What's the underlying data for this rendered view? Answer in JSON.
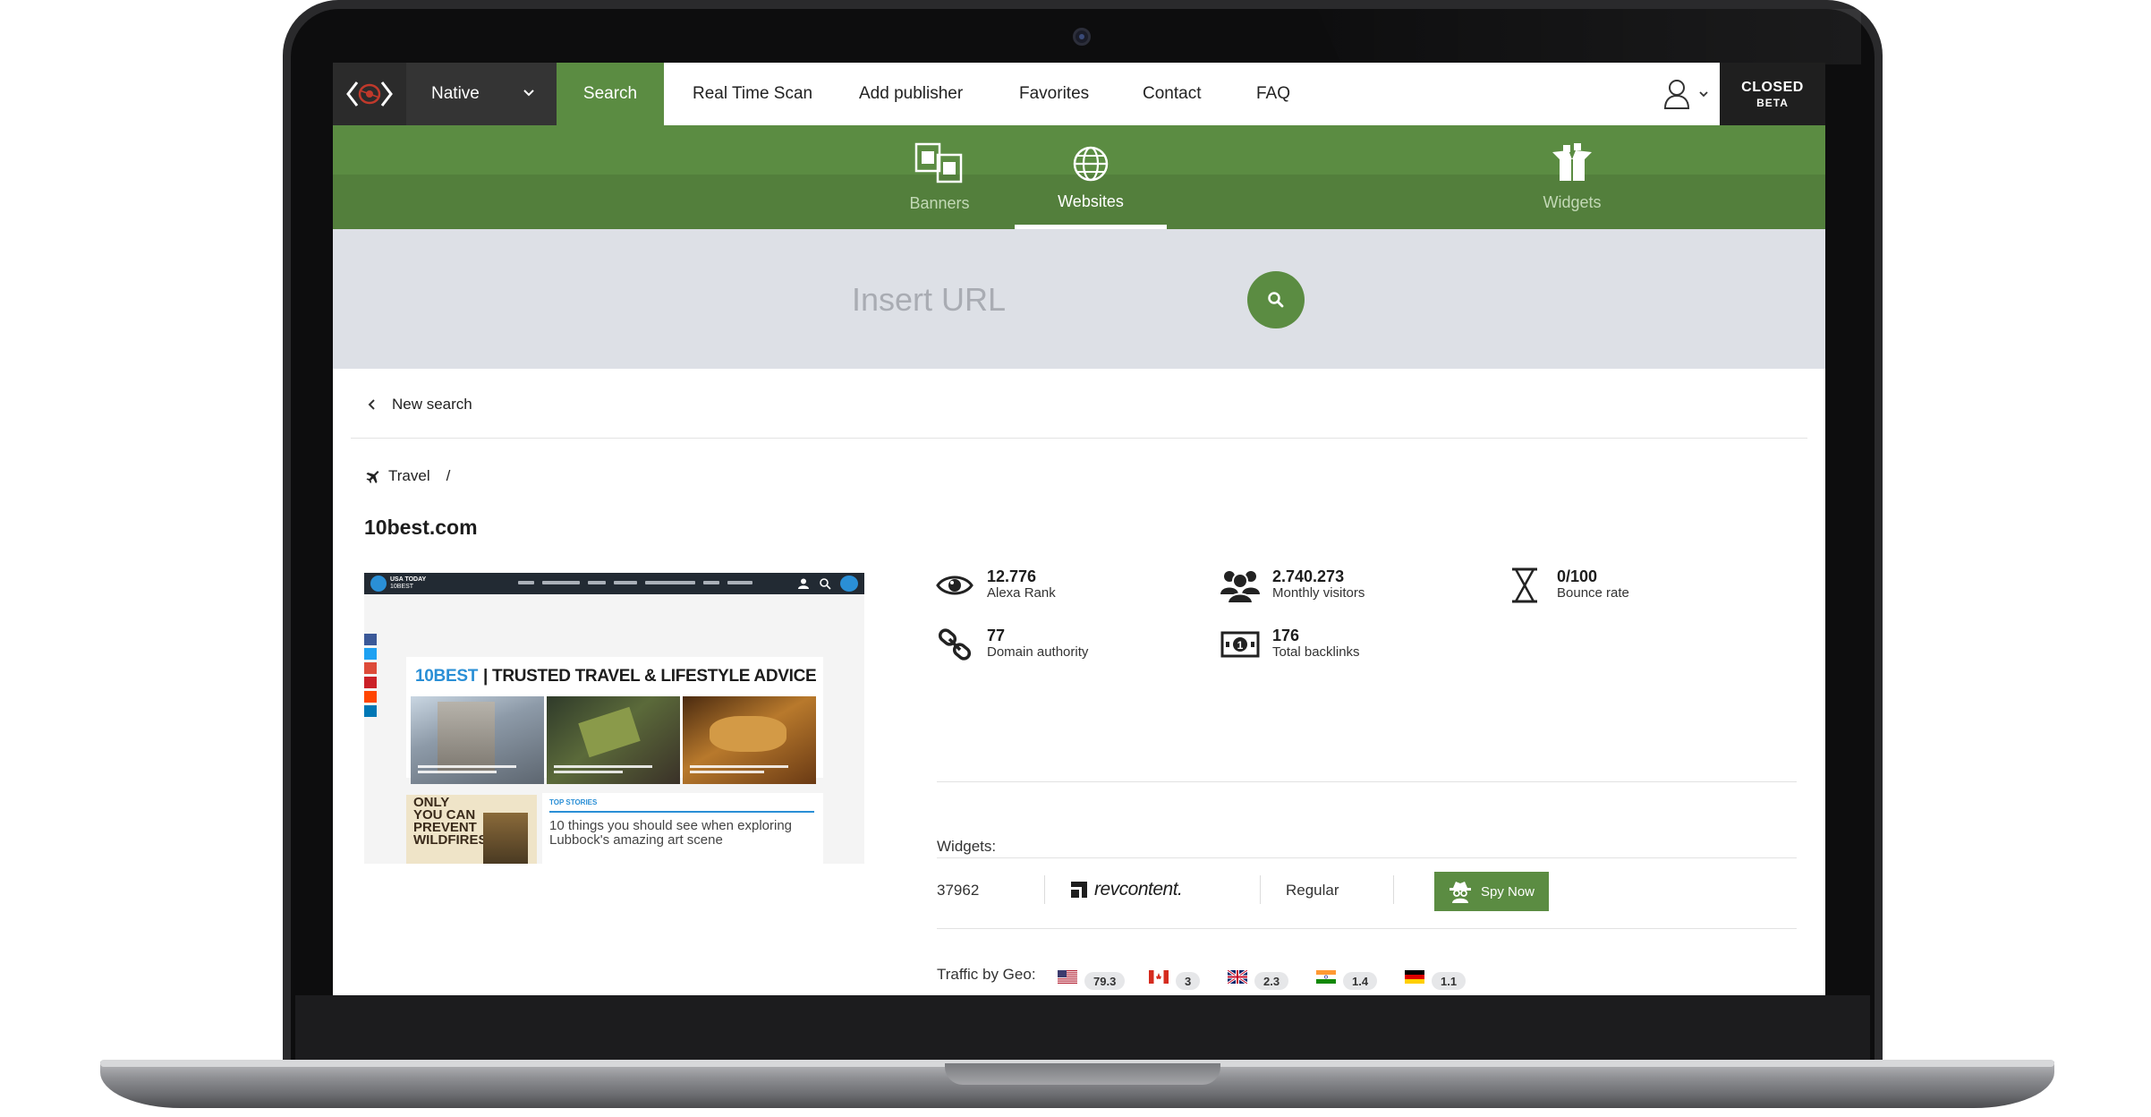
{
  "topnav": {
    "selector_value": "Native",
    "active_tab": "Search",
    "menu": [
      "Real Time Scan",
      "Add publisher",
      "Favorites",
      "Contact",
      "FAQ"
    ],
    "badge_line1": "CLOSED",
    "badge_line2": "BETA"
  },
  "subnav": {
    "tabs": [
      {
        "label": "Banners",
        "icon": "banners-icon"
      },
      {
        "label": "Websites",
        "icon": "globe-icon"
      },
      {
        "label": "Widgets",
        "icon": "widgets-icon"
      }
    ],
    "active": "Websites"
  },
  "search": {
    "placeholder": "Insert URL"
  },
  "content": {
    "back_label": "New search",
    "breadcrumb": {
      "category": "Travel",
      "separator": "/"
    },
    "domain": "10best.com",
    "thumbnail": {
      "brand_line1": "USA TODAY",
      "brand_line2": "10BEST",
      "headline_brand": "10BEST",
      "headline_rest": "| TRUSTED TRAVEL & LIFESTYLE ADVICE",
      "poster_text": "ONLY YOU CAN PREVENT WILDFIRES",
      "section_label": "TOP STORIES",
      "story_title": "10 things you should see when exploring Lubbock's amazing art scene"
    },
    "stats": [
      {
        "value": "12.776",
        "label": "Alexa Rank",
        "icon": "eye-icon"
      },
      {
        "value": "2.740.273",
        "label": "Monthly visitors",
        "icon": "users-icon"
      },
      {
        "value": "0/100",
        "label": "Bounce rate",
        "icon": "hourglass-icon"
      },
      {
        "value": "77",
        "label": "Domain authority",
        "icon": "link-icon"
      },
      {
        "value": "176",
        "label": "Total backlinks",
        "icon": "money-icon"
      }
    ],
    "widgets": {
      "label": "Widgets:",
      "rows": [
        {
          "id": "37962",
          "network": "revcontent.",
          "type": "Regular",
          "action": "Spy Now"
        }
      ]
    },
    "geo": {
      "label": "Traffic by Geo:",
      "items": [
        {
          "country": "US",
          "value": "79.3"
        },
        {
          "country": "CA",
          "value": "3"
        },
        {
          "country": "GB",
          "value": "2.3"
        },
        {
          "country": "IN",
          "value": "1.4"
        },
        {
          "country": "DE",
          "value": "1.1"
        }
      ]
    }
  },
  "colors": {
    "brand_green": "#5b8c42",
    "dark_nav": "#2b2b2b",
    "url_band": "#dde0e6"
  }
}
